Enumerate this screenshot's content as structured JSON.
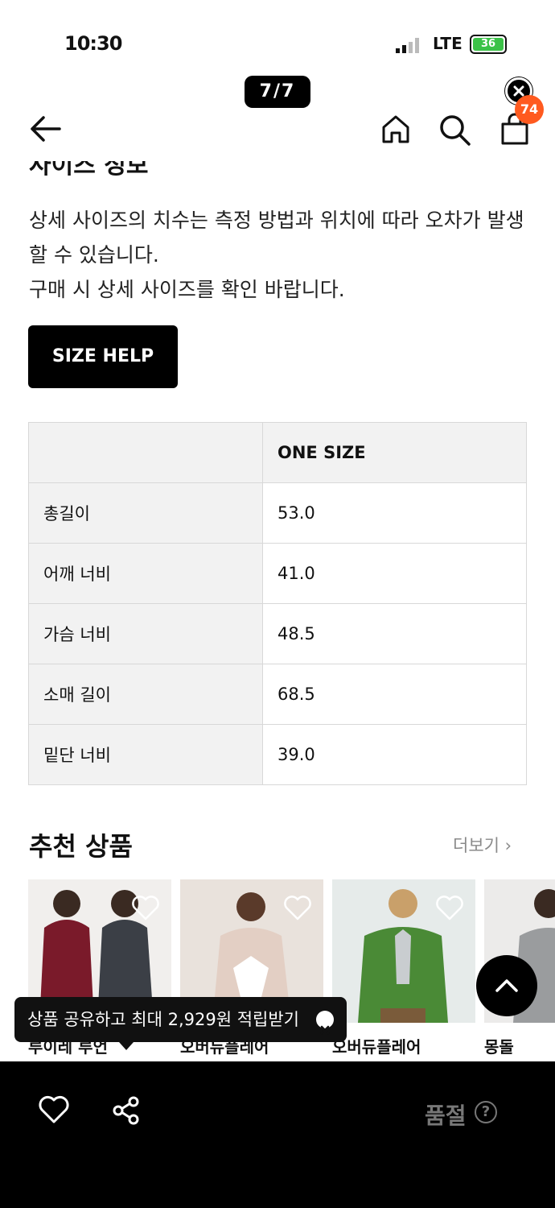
{
  "status_bar": {
    "time": "10:30",
    "network": "LTE",
    "battery": "36"
  },
  "viewer": {
    "page_indicator": "7/7"
  },
  "header": {
    "cart_count": "74"
  },
  "size_info": {
    "section_title_cut": "사이즈 정보",
    "notice_line1": "상세 사이즈의 치수는 측정 방법과 위치에 따라 오차가 발생할 수 있습니다.",
    "notice_line2": "구매 시 상세 사이즈를 확인 바랍니다.",
    "size_help_label": "SIZE HELP",
    "table": {
      "columns": [
        "",
        "ONE SIZE"
      ],
      "rows": [
        {
          "label": "총길이",
          "value": "53.0"
        },
        {
          "label": "어깨 너비",
          "value": "41.0"
        },
        {
          "label": "가슴 너비",
          "value": "48.5"
        },
        {
          "label": "소매 길이",
          "value": "68.5"
        },
        {
          "label": "밑단 너비",
          "value": "39.0"
        }
      ]
    }
  },
  "recommended": {
    "title": "추천 상품",
    "more_label": "더보기",
    "products": [
      {
        "brand": "루이레 루언"
      },
      {
        "brand": "오버듀플레어"
      },
      {
        "brand": "오버듀플레어"
      },
      {
        "brand": "몽돌"
      }
    ]
  },
  "share_tooltip": {
    "text": "상품 공유하고 최대 2,929원 적립받기"
  },
  "bottom_bar": {
    "status_label": "품절",
    "help_symbol": "?"
  },
  "colors": {
    "accent_badge": "#ff5a1f",
    "battery_green": "#3bc248",
    "bar_bg": "#000000"
  }
}
